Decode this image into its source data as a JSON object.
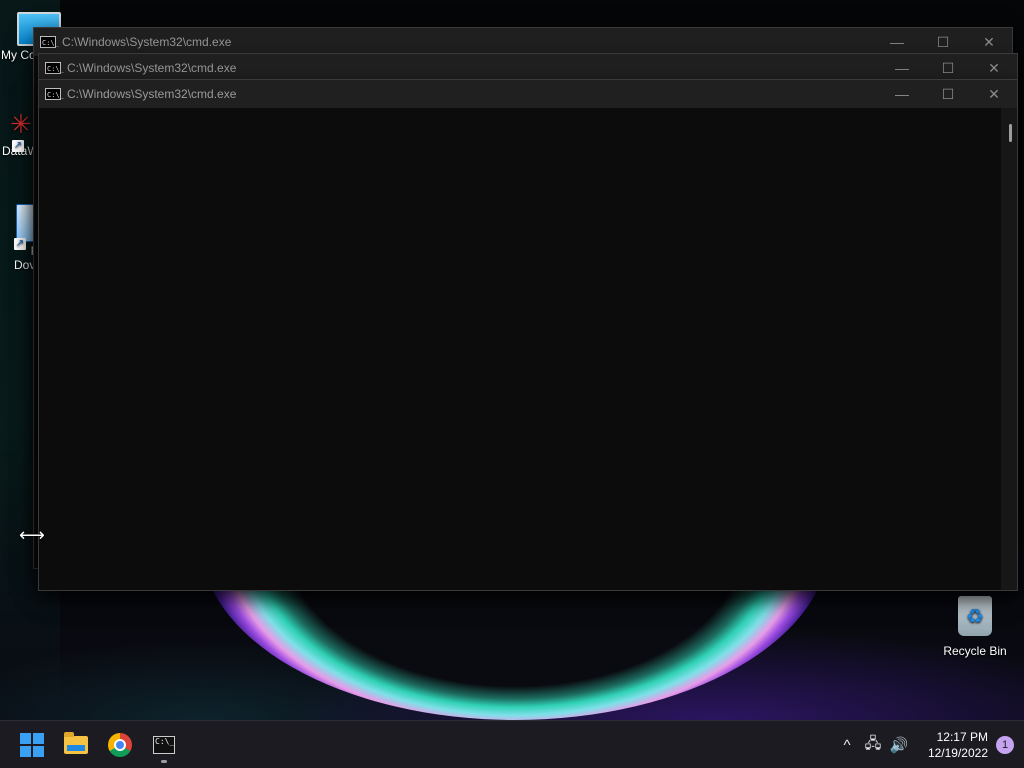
{
  "desktop": {
    "icons": [
      {
        "label": "My Co",
        "icon": "computer-icon"
      },
      {
        "label": "DataW",
        "icon": "datawarehouse-shortcut-icon"
      },
      {
        "label": "F",
        "label2": "Dov",
        "icon": "file-downloader-shortcut-icon"
      }
    ],
    "recycle_bin": {
      "label": "Recycle Bin",
      "icon": "recycle-bin-icon"
    }
  },
  "windows": [
    {
      "title": "C:\\Windows\\System32\\cmd.exe"
    },
    {
      "title": "C:\\Windows\\System32\\cmd.exe"
    },
    {
      "title": "C:\\Windows\\System32\\cmd.exe"
    }
  ],
  "window_controls": {
    "minimize": "—",
    "maximize": "☐",
    "close": "✕"
  },
  "cmd_icon_text": "C:\\_",
  "taskbar": {
    "apps": [
      {
        "name": "start",
        "icon": "windows-start-icon"
      },
      {
        "name": "file-explorer",
        "icon": "folder-icon"
      },
      {
        "name": "chrome",
        "icon": "chrome-icon"
      },
      {
        "name": "command-prompt",
        "icon": "terminal-icon",
        "active": true
      }
    ],
    "tray": {
      "chevron": "^",
      "network": "🖧",
      "volume": "🔊",
      "time": "12:17 PM",
      "date": "12/19/2022",
      "notification_count": "1"
    }
  },
  "cursor": "⟷",
  "colors": {
    "console_bg": "#0c0c0c",
    "titlebar_bg": "#202020",
    "start_blue": "#3aa0f3"
  }
}
